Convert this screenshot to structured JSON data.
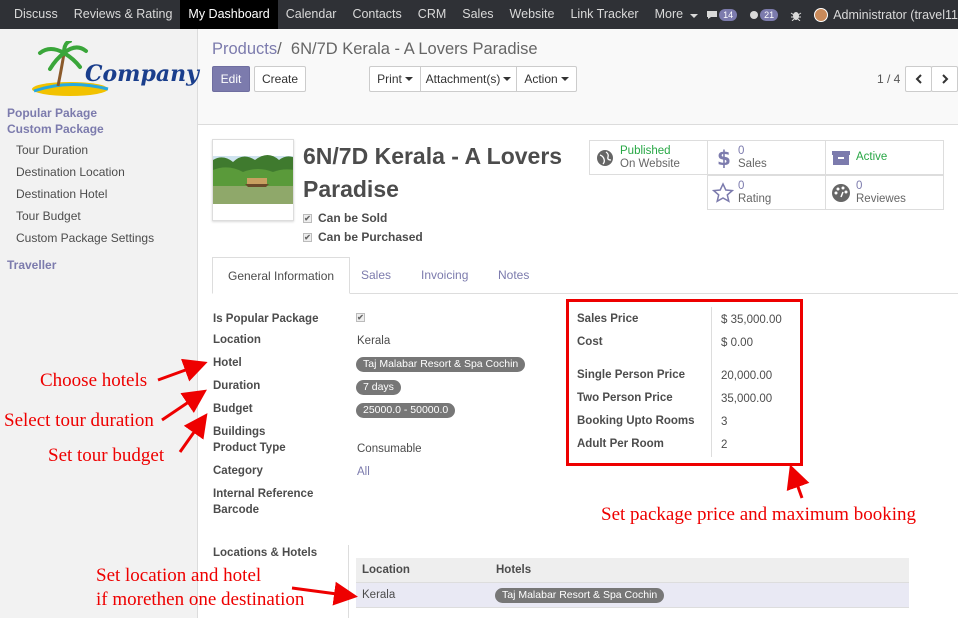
{
  "topnav": {
    "items": [
      {
        "label": "Discuss",
        "active": false
      },
      {
        "label": "Reviews & Rating",
        "active": false
      },
      {
        "label": "My Dashboard",
        "active": true
      },
      {
        "label": "Calendar",
        "active": false
      },
      {
        "label": "Contacts",
        "active": false
      },
      {
        "label": "CRM",
        "active": false
      },
      {
        "label": "Sales",
        "active": false
      },
      {
        "label": "Website",
        "active": false
      },
      {
        "label": "Link Tracker",
        "active": false
      },
      {
        "label": "More",
        "active": false
      }
    ],
    "messages_count": "14",
    "chat_count": "21",
    "user": "Administrator (travel11"
  },
  "sidebar": {
    "logo_text": "Company",
    "section_popular": "Popular Pakage",
    "section_custom": "Custom Package",
    "items": [
      "Tour Duration",
      "Destination Location",
      "Destination Hotel",
      "Tour Budget",
      "Custom Package Settings"
    ],
    "section_traveller": "Traveller"
  },
  "breadcrumb": {
    "parent": "Products",
    "separator": "/",
    "current": "6N/7D Kerala - A Lovers Paradise"
  },
  "buttons": {
    "edit": "Edit",
    "create": "Create",
    "print": "Print",
    "attachments": "Attachment(s)",
    "action": "Action"
  },
  "pager": {
    "text": "1 / 4"
  },
  "product": {
    "title": "6N/7D Kerala - A Lovers Paradise",
    "can_be_sold": "Can be Sold",
    "can_be_purchased": "Can be Purchased"
  },
  "stats": {
    "published_1": "Published",
    "published_2": "On Website",
    "sales_count": "0",
    "sales_label": "Sales",
    "active_label": "Active",
    "rating_count": "0",
    "rating_label": "Rating",
    "reviews_count": "0",
    "reviews_label": "Reviewes"
  },
  "tabs": [
    "General Information",
    "Sales",
    "Invoicing",
    "Notes"
  ],
  "general": {
    "is_popular_label": "Is Popular Package",
    "location_label": "Location",
    "location_value": "Kerala",
    "hotel_label": "Hotel",
    "hotel_value": "Taj Malabar Resort & Spa Cochin",
    "duration_label": "Duration",
    "duration_value": "7 days",
    "budget_label": "Budget",
    "budget_value": "25000.0 - 50000.0",
    "buildings_label": "Buildings",
    "product_type_label": "Product Type",
    "product_type_value": "Consumable",
    "category_label": "Category",
    "category_value": "All",
    "internal_ref_label": "Internal Reference",
    "barcode_label": "Barcode",
    "locations_hotels_label": "Locations & Hotels"
  },
  "pricing": {
    "sales_price_label": "Sales Price",
    "sales_price_value": "$ 35,000.00",
    "cost_label": "Cost",
    "cost_value": "$ 0.00",
    "single_label": "Single Person Price",
    "single_value": "20,000.00",
    "two_label": "Two Person Price",
    "two_value": "35,000.00",
    "rooms_label": "Booking Upto Rooms",
    "rooms_value": "3",
    "adult_label": "Adult Per Room",
    "adult_value": "2"
  },
  "loc_table": {
    "col_location": "Location",
    "col_hotels": "Hotels",
    "row_location": "Kerala",
    "row_hotel": "Taj Malabar Resort & Spa Cochin"
  },
  "annotations": {
    "choose_hotels": "Choose hotels",
    "select_duration": "Select tour duration",
    "set_budget": "Set tour budget",
    "set_price": "Set package price and maximum booking",
    "set_location_1": "Set location and hotel",
    "set_location_2": "if morethen one destination"
  },
  "colors": {
    "accent": "#7c7bad",
    "annotation": "#ee0000",
    "nav_bg": "#2f3136"
  }
}
